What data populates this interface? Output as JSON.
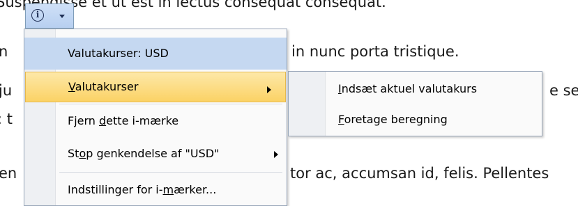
{
  "document": {
    "line0": "Suspendisse et ut est in lectus consequat consequat.",
    "line1_right": "in nunc porta tristique.",
    "line1_left": "n",
    "line2_left": "ju",
    "line2_right": "e se",
    "line3_left": ": t",
    "line4_left": "en",
    "line4_right": "tor ac, accumsan id, felis. Pellentes"
  },
  "smart_tag": {
    "info_glyph": "i"
  },
  "menu": {
    "header": "Valutakurser: USD",
    "valutakurser_pre": "",
    "valutakurser_u": "V",
    "valutakurser_post": "alutakurser",
    "fjern_pre": "Fjern ",
    "fjern_u": "d",
    "fjern_post": "ette i-mærke",
    "stop_pre": "St",
    "stop_u": "o",
    "stop_post": "p genkendelse af \"USD\"",
    "indstillinger_pre": "Indstillinger for i-",
    "indstillinger_u": "m",
    "indstillinger_post": "ærker..."
  },
  "submenu": {
    "indsaet_u": "I",
    "indsaet_post": "ndsæt aktuel valutakurs",
    "foretage_u": "F",
    "foretage_post": "oretage beregning"
  },
  "colors": {
    "highlight": "#fbd265",
    "header_bg": "#c5d8f1",
    "smart_tag_bg": "#b7cff0"
  }
}
